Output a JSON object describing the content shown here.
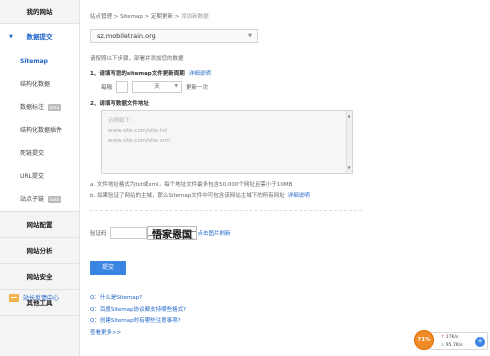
{
  "sidebar": {
    "header": "我的网站",
    "active_section": "数据提交",
    "items": [
      {
        "label": "Sitemap",
        "beta": ""
      },
      {
        "label": "结构化数据",
        "beta": ""
      },
      {
        "label": "数据标注",
        "beta": "beta"
      },
      {
        "label": "结构化数据插件",
        "beta": ""
      },
      {
        "label": "死链提交",
        "beta": ""
      },
      {
        "label": "URL提交",
        "beta": ""
      },
      {
        "label": "站点子链",
        "beta": "beta"
      }
    ],
    "sections": [
      "网站配置",
      "网站分析",
      "网站安全",
      "其他工具"
    ],
    "feedback": "站长反馈中心"
  },
  "breadcrumb": {
    "parts": [
      "站点管理",
      "Sitemap",
      "定期更新"
    ],
    "separator": " > ",
    "current": "添加新数据"
  },
  "site_select": {
    "value": "sz.mobiletrain.org"
  },
  "tip": "请按照以下步骤，部署并添加您的数据",
  "step1": {
    "title": "1、请填写您的sitemap文件更新周期",
    "link": "详细说明",
    "prefix": "每隔",
    "unit": "天",
    "suffix": "更新一次",
    "value": ""
  },
  "step2": {
    "title": "2、请填写数据文件地址",
    "placeholder_lines": [
      "示例如下：",
      "www.site.com/site.txt",
      "www.site.com/site.xml"
    ]
  },
  "notes": {
    "a": "a. 文件地址格式为txt或xml，每个地址文件最多包含50,000个网址且需小于10MB",
    "b": "b. 如果验证了网站的主域，那么Sitemap文件中可包含该网站主域下的所有网址",
    "b_link": "详细说明"
  },
  "captcha": {
    "label": "验证码",
    "value": "",
    "image_text": "悟家恩国",
    "refresh": "点击图片刷新"
  },
  "submit_label": "提交",
  "faq": {
    "items": [
      "Q：什么是Sitemap?",
      "Q：百度Sitemap协议都支持哪些格式?",
      "Q：创建Sitemap时有哪些注意事项?"
    ],
    "more": "查看更多>>"
  },
  "widget": {
    "percent": "71%",
    "up": "17K/s",
    "down": "95.7K/s"
  },
  "colors": {
    "accent": "#1e64c8",
    "button": "#3a84e4",
    "widget": "#f08a24"
  }
}
